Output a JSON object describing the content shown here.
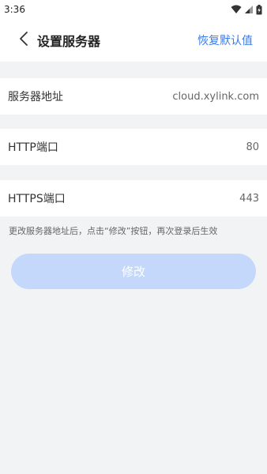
{
  "status_bar": {
    "time": "3:36"
  },
  "header": {
    "title": "设置服务器",
    "restore_label": "恢复默认值"
  },
  "settings": {
    "server": {
      "label": "服务器地址",
      "value": "cloud.xylink.com"
    },
    "http": {
      "label": "HTTP端口",
      "value": "80"
    },
    "https": {
      "label": "HTTPS端口",
      "value": "443"
    }
  },
  "hint": "更改服务器地址后，点击“修改”按钮，再次登录后生效",
  "modify_label": "修改",
  "colors": {
    "accent": "#3a7be8",
    "button_disabled": "#c4d8fc",
    "background": "#f2f3f5"
  }
}
